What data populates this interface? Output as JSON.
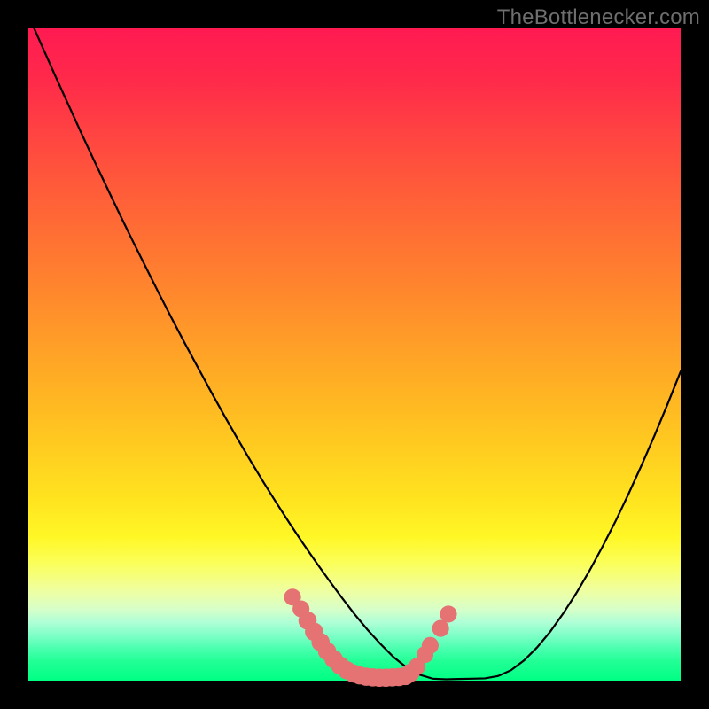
{
  "attribution": "TheBottlenecker.com",
  "chart_data": {
    "type": "line",
    "title": "",
    "xlabel": "",
    "ylabel": "",
    "xlim": [
      0,
      100
    ],
    "ylim": [
      0,
      100
    ],
    "x": [
      0,
      2,
      4,
      6,
      8,
      10,
      12,
      14,
      16,
      18,
      20,
      22,
      24,
      26,
      28,
      30,
      32,
      34,
      36,
      38,
      40,
      42,
      44,
      46,
      48,
      50,
      52,
      54,
      56,
      58,
      60,
      62,
      64,
      66,
      68,
      70,
      72,
      74,
      76,
      78,
      80,
      82,
      84,
      86,
      88,
      90,
      92,
      94,
      96,
      98,
      100
    ],
    "values": [
      102,
      97.5,
      93,
      88.6,
      84.2,
      79.9,
      75.7,
      71.5,
      67.4,
      63.4,
      59.4,
      55.5,
      51.7,
      48,
      44.3,
      40.7,
      37.2,
      33.8,
      30.5,
      27.3,
      24.2,
      21.2,
      18.3,
      15.5,
      12.8,
      10.2,
      7.8,
      5.6,
      3.6,
      2,
      0.9,
      0.3,
      0.2,
      0.25,
      0.3,
      0.35,
      0.7,
      1.6,
      3.1,
      5.1,
      7.5,
      10.3,
      13.4,
      16.8,
      20.5,
      24.4,
      28.6,
      33,
      37.6,
      42.4,
      47.4
    ],
    "annotations": [
      {
        "x": 40.5,
        "y": 12.8,
        "r": 1.3
      },
      {
        "x": 41.8,
        "y": 11.0,
        "r": 1.3
      },
      {
        "x": 42.8,
        "y": 9.2,
        "r": 1.4
      },
      {
        "x": 43.8,
        "y": 7.5,
        "r": 1.4
      },
      {
        "x": 44.8,
        "y": 5.9,
        "r": 1.4
      },
      {
        "x": 45.8,
        "y": 4.5,
        "r": 1.4
      },
      {
        "x": 46.8,
        "y": 3.3,
        "r": 1.4
      },
      {
        "x": 47.8,
        "y": 2.3,
        "r": 1.4
      },
      {
        "x": 48.8,
        "y": 1.6,
        "r": 1.4
      },
      {
        "x": 49.8,
        "y": 1.1,
        "r": 1.4
      },
      {
        "x": 50.8,
        "y": 0.8,
        "r": 1.4
      },
      {
        "x": 51.8,
        "y": 0.6,
        "r": 1.4
      },
      {
        "x": 52.8,
        "y": 0.5,
        "r": 1.4
      },
      {
        "x": 53.8,
        "y": 0.45,
        "r": 1.4
      },
      {
        "x": 54.8,
        "y": 0.45,
        "r": 1.4
      },
      {
        "x": 55.8,
        "y": 0.5,
        "r": 1.4
      },
      {
        "x": 56.8,
        "y": 0.55,
        "r": 1.4
      },
      {
        "x": 57.8,
        "y": 0.7,
        "r": 1.4
      },
      {
        "x": 58.6,
        "y": 1.2,
        "r": 1.4
      },
      {
        "x": 59.6,
        "y": 2.2,
        "r": 1.3
      },
      {
        "x": 60.8,
        "y": 4.0,
        "r": 1.3
      },
      {
        "x": 61.6,
        "y": 5.4,
        "r": 1.3
      },
      {
        "x": 63.2,
        "y": 8.0,
        "r": 1.3
      },
      {
        "x": 64.4,
        "y": 10.2,
        "r": 1.3
      }
    ],
    "colors": {
      "curve": "#000000",
      "marker": "#e57373"
    }
  }
}
